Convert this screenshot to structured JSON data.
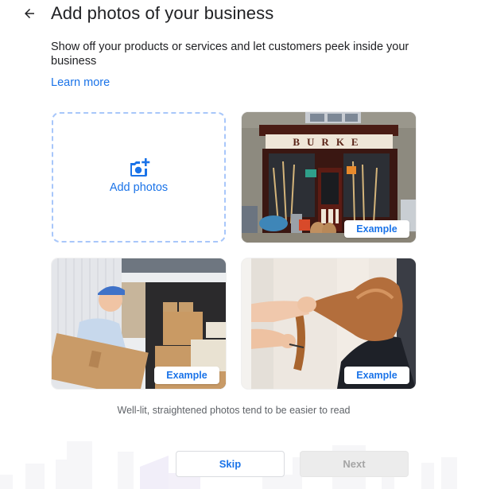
{
  "header": {
    "back_icon": "arrow-left-icon",
    "title": "Add photos of your business"
  },
  "intro": {
    "description": "Show off your products or services and let customers peek inside your business",
    "learn_more": "Learn more"
  },
  "upload": {
    "icon": "add-a-photo-icon",
    "label": "Add photos"
  },
  "examples": [
    {
      "subject": "hardware store storefront with sign BURKE",
      "sign_text": "BURKE",
      "badge": "Example"
    },
    {
      "subject": "delivery worker in blue cap carrying a cardboard box from a van",
      "badge": "Example"
    },
    {
      "subject": "hairdresser combing long hair in a salon",
      "badge": "Example"
    }
  ],
  "tip": "Well-lit, straightened photos tend to be easier to read",
  "footer": {
    "skip_label": "Skip",
    "next_label": "Next",
    "next_enabled": false
  },
  "colors": {
    "accent": "#1a73e8",
    "dashed_border": "#a8c7fa",
    "text_primary": "#202124",
    "text_secondary": "#5f6368",
    "disabled_bg": "#ececec",
    "disabled_text": "#a5a5a5"
  }
}
